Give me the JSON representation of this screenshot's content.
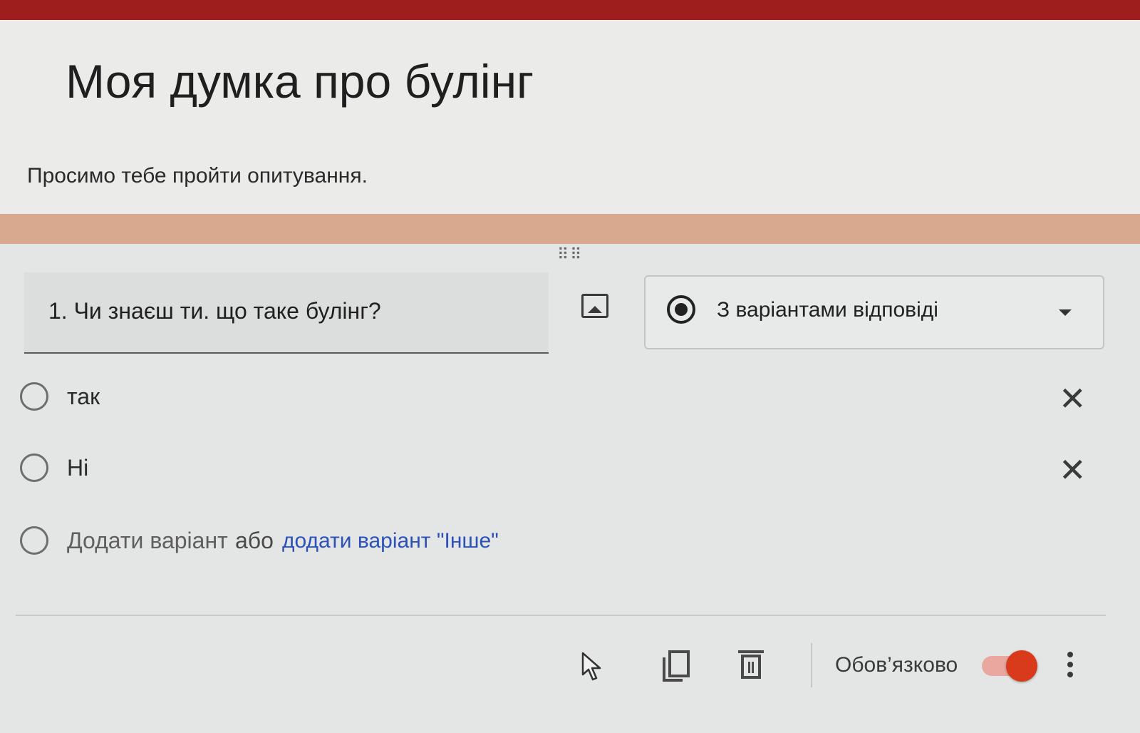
{
  "form": {
    "title": "Моя думка про булінг",
    "description": "Просимо тебе пройти опитування.",
    "accent_color": "#9e1d1d"
  },
  "question": {
    "text": "1. Чи знаєш ти. що таке булінг?",
    "type_label": "З варіантами відповіді",
    "options": [
      {
        "label": "так"
      },
      {
        "label": "Hi"
      }
    ],
    "add_option_label": "Додати варіант",
    "or_label": "або",
    "add_other_label": "додати варіант \"Інше\"",
    "required_label": "Обов’язково",
    "required_on": true
  },
  "icons": {
    "drag": "drag-handle-icon",
    "image": "image-icon",
    "type": "radio-button-icon",
    "dropdown": "chevron-down-icon",
    "remove": "close-icon",
    "cursor": "cursor-icon",
    "duplicate": "copy-icon",
    "delete": "trash-icon",
    "more": "more-vertical-icon"
  }
}
